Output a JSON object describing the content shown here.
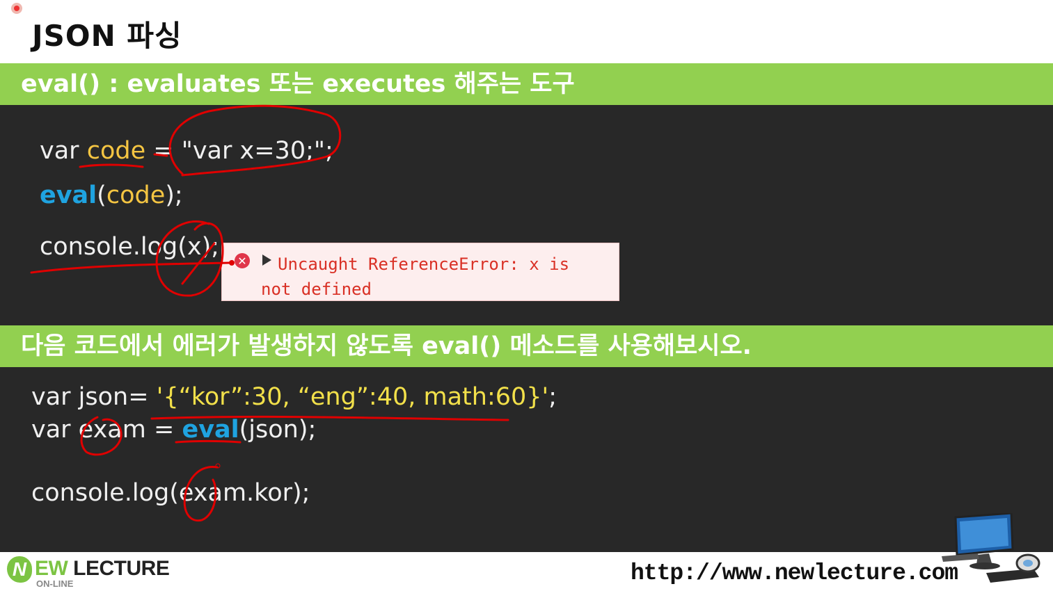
{
  "slide": {
    "title": "JSON 파싱"
  },
  "section1": {
    "heading": "eval() : evaluates 또는 executes 해주는 도구",
    "line1": {
      "kw": "var",
      "name": "code",
      "eq": "=",
      "value": "\"var x=30;\";"
    },
    "line2": {
      "fn": "eval",
      "open": "(",
      "arg": "code",
      "close": ");"
    },
    "line3": {
      "text": "console.log(x);"
    },
    "error": {
      "message": "Uncaught ReferenceError: x is not defined"
    }
  },
  "section2": {
    "heading": "다음 코드에서 에러가 발생하지 않도록 eval() 메소드를 사용해보시오.",
    "line1": {
      "kw": "var json=",
      "value": "'{“kor”:30, “eng”:40, math:60}'",
      "end": ";"
    },
    "line2": {
      "kw": "var exam =",
      "fn": "eval",
      "rest": "(json);"
    },
    "line3": {
      "text": "console.log(exam.kor);"
    }
  },
  "footer": {
    "logo_n": "N",
    "logo_ew": "EW",
    "logo_lecture": " LECTURE",
    "logo_sub": "ON-LINE",
    "url": "http://www.newlecture.com"
  },
  "colors": {
    "green_bar": "#92d050",
    "panel_bg": "#282828",
    "eval_blue": "#1fa3e0",
    "var_yellow": "#f5c542",
    "annotation_red": "#e00000",
    "error_red": "#d93025"
  },
  "icons": [
    "record-dot-icon",
    "error-circle-icon",
    "expand-triangle-icon",
    "computer-illustration-icon"
  ]
}
